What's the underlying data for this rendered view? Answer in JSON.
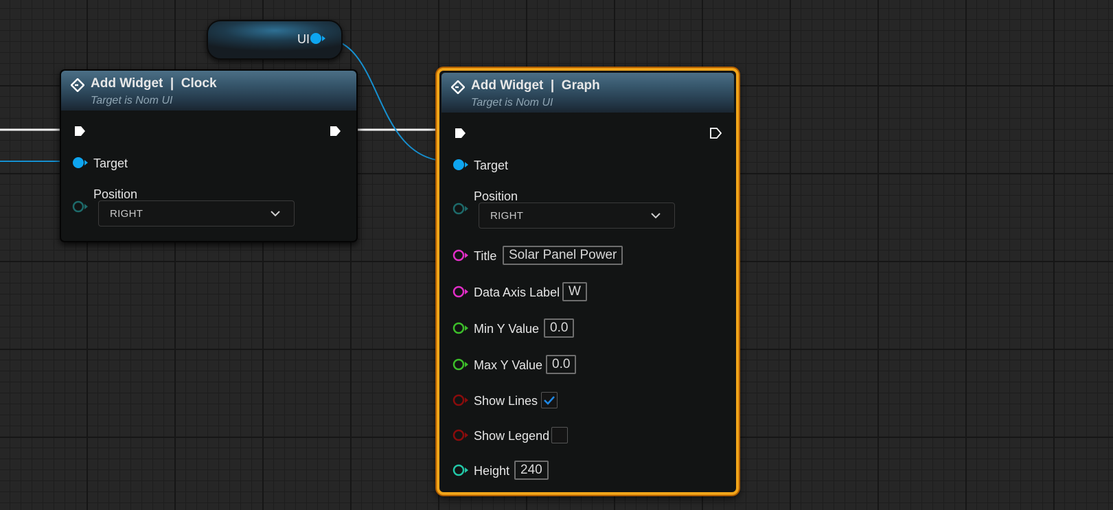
{
  "variable_node": {
    "label": "UI"
  },
  "nodes": [
    {
      "id": "clock",
      "title": "Add Widget  |  Clock",
      "subtitle": "Target is Nom UI",
      "target_label": "Target",
      "position_label": "Position",
      "position_value": "RIGHT"
    },
    {
      "id": "graph",
      "title": "Add Widget  |  Graph",
      "subtitle": "Target is Nom UI",
      "target_label": "Target",
      "position_label": "Position",
      "position_value": "RIGHT",
      "title_label": "Title",
      "title_value": "Solar Panel Power",
      "data_axis_label": "Data Axis Label",
      "data_axis_value": "W",
      "min_y_label": "Min Y Value",
      "min_y_value": "0.0",
      "max_y_label": "Max Y Value",
      "max_y_value": "0.0",
      "show_lines_label": "Show Lines",
      "show_lines_checked": true,
      "show_legend_label": "Show Legend",
      "show_legend_checked": false,
      "height_label": "Height",
      "height_value": "240"
    }
  ],
  "colors": {
    "object_pin": "#0ea5f0",
    "enum_pin": "#1d6a6a",
    "string_pin": "#e22ec8",
    "float_pin": "#3dbf2a",
    "bool_pin": "#8a0c0c",
    "int_pin": "#22c8a8",
    "exec_pin": "#ffffff",
    "selection_outline": "#f1a51a"
  }
}
